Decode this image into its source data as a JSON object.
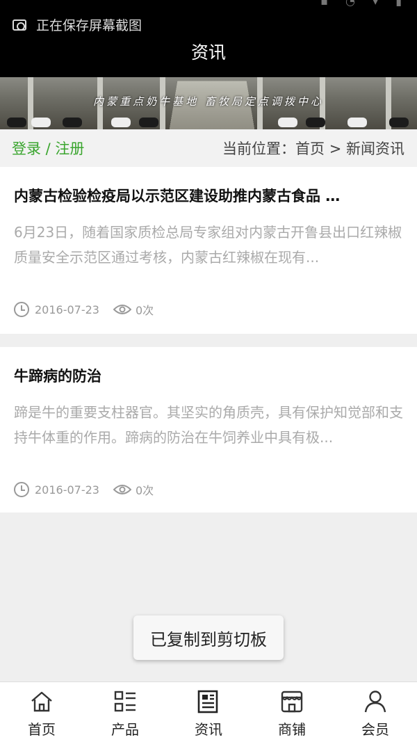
{
  "status_bar": {
    "notification": "正在保存屏幕截图"
  },
  "header": {
    "title": "资讯"
  },
  "banner": {
    "caption": "内蒙重点奶牛基地  畜牧局定点调拨中心"
  },
  "crumb_bar": {
    "login_register": "登录 / 注册",
    "location": "当前位置：首页 > 新闻资讯"
  },
  "articles": [
    {
      "title": "内蒙古检验检疫局以示范区建设助推内蒙古食品 …",
      "excerpt": "6月23日，随着国家质检总局专家组对内蒙古开鲁县出口红辣椒质量安全示范区通过考核，内蒙古红辣椒在现有...",
      "date": "2016-07-23",
      "views": "0次"
    },
    {
      "title": "牛蹄病的防治",
      "excerpt": "蹄是牛的重要支柱器官。其坚实的角质壳，具有保护知觉部和支持牛体重的作用。蹄病的防治在牛饲养业中具有极...",
      "date": "2016-07-23",
      "views": "0次"
    }
  ],
  "toast": {
    "text": "已复制到剪切板"
  },
  "tabbar": {
    "items": [
      {
        "label": "首页",
        "icon": "home-icon"
      },
      {
        "label": "产品",
        "icon": "grid-list-icon"
      },
      {
        "label": "资讯",
        "icon": "newspaper-icon"
      },
      {
        "label": "商铺",
        "icon": "shop-icon"
      },
      {
        "label": "会员",
        "icon": "user-icon"
      }
    ]
  },
  "colors": {
    "accent_green": "#3aa52e",
    "header_bg": "#000000"
  }
}
